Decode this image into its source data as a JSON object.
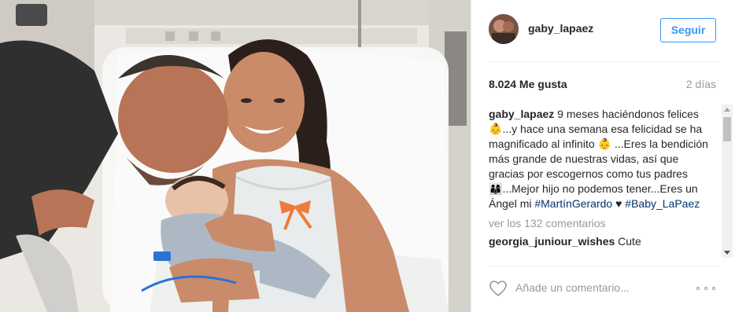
{
  "post": {
    "username": "gaby_lapaez",
    "follow_label": "Seguir",
    "likes": "8.024 Me gusta",
    "time_ago": "2 días",
    "caption_user": "gaby_lapaez",
    "caption_part1": " 9 meses haciéndonos felices ",
    "caption_icon1": "👶",
    "caption_part2": "...y hace una semana esa felicidad se ha magnificado al infinito ",
    "caption_icon2": "👶",
    "caption_part3": " ...Eres la bendición más grande de nuestras vidas, así que gracias por escogernos como tus padres ",
    "caption_icon3": "👨‍👩‍👦",
    "caption_part4": "...Mejor hijo no podemos tener...Eres un Ángel mi ",
    "hashtag1": "#MartínGerardo",
    "heart_symbol": "♥",
    "hashtag2": "#Baby_LaPaez",
    "view_all": "ver los 132 comentarios",
    "comment_user": "georgia_juniour_wishes",
    "comment_text": "Cute",
    "add_comment_placeholder": "Añade un comentario..."
  },
  "colors": {
    "accent": "#3897f0",
    "hashtag": "#003569",
    "muted": "#999999"
  },
  "icons": {
    "like": "heart-outline-icon",
    "options": "more-options-icon"
  }
}
